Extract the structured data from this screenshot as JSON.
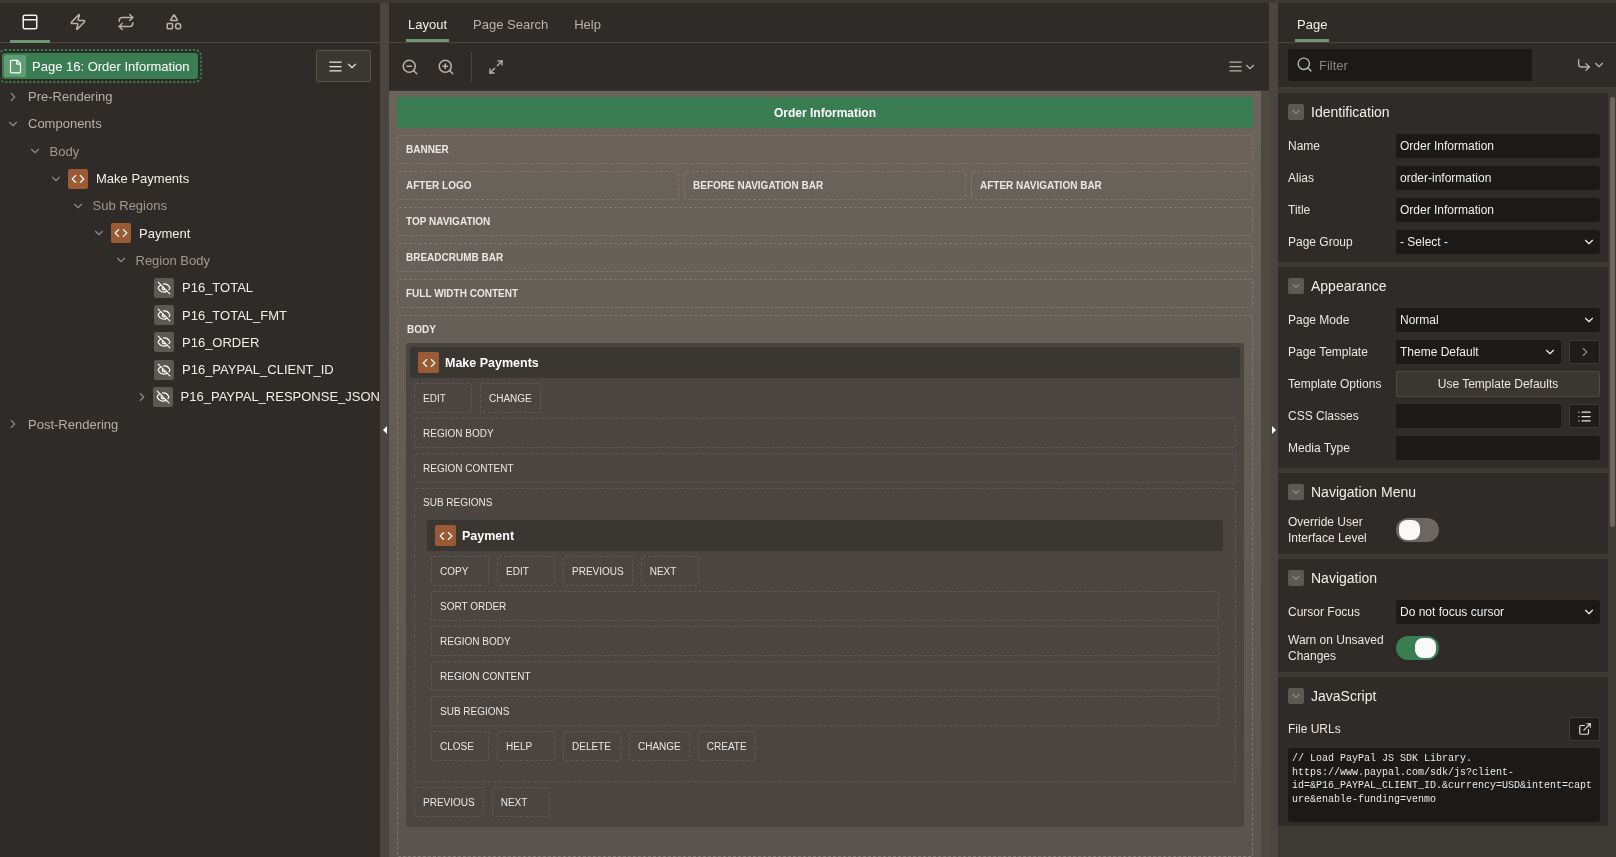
{
  "left_tabs": [
    {
      "kind": "rendering",
      "selected": true
    },
    {
      "kind": "dynamic_actions",
      "selected": false
    },
    {
      "kind": "processing",
      "selected": false
    },
    {
      "kind": "shared_components",
      "selected": false
    }
  ],
  "tree": {
    "label": "Page 16: Order Information",
    "selected": true,
    "children": [
      {
        "kind": "group",
        "label": "Pre-Rendering",
        "expanded": false
      },
      {
        "kind": "group",
        "label": "Components",
        "expanded": true,
        "children": [
          {
            "kind": "folder",
            "label": "Body",
            "expanded": true,
            "children": [
              {
                "kind": "region",
                "label": "Make Payments",
                "expanded": true,
                "children": [
                  {
                    "kind": "folder",
                    "label": "Sub Regions",
                    "expanded": true,
                    "children": [
                      {
                        "kind": "region",
                        "label": "Payment",
                        "expanded": true,
                        "children": [
                          {
                            "kind": "folder",
                            "label": "Region Body",
                            "expanded": true,
                            "children": [
                              {
                                "kind": "item",
                                "label": "P16_TOTAL"
                              },
                              {
                                "kind": "item",
                                "label": "P16_TOTAL_FMT"
                              },
                              {
                                "kind": "item",
                                "label": "P16_ORDER"
                              },
                              {
                                "kind": "item",
                                "label": "P16_PAYPAL_CLIENT_ID"
                              },
                              {
                                "kind": "item",
                                "label": "P16_PAYPAL_RESPONSE_JSON",
                                "expanded": false
                              }
                            ]
                          }
                        ]
                      }
                    ]
                  }
                ]
              }
            ]
          }
        ]
      },
      {
        "kind": "group",
        "label": "Post-Rendering",
        "expanded": false
      }
    ]
  },
  "center_tabs": [
    {
      "label": "Layout",
      "selected": true
    },
    {
      "label": "Page Search",
      "selected": false
    },
    {
      "label": "Help",
      "selected": false
    }
  ],
  "canvas": {
    "title": "Order Information",
    "positions": [
      {
        "labels": [
          "BANNER"
        ]
      },
      {
        "labels": [
          "AFTER LOGO",
          "BEFORE NAVIGATION BAR",
          "AFTER NAVIGATION BAR"
        ]
      },
      {
        "labels": [
          "TOP NAVIGATION"
        ]
      },
      {
        "labels": [
          "BREADCRUMB BAR"
        ]
      },
      {
        "labels": [
          "FULL WIDTH CONTENT"
        ]
      }
    ],
    "body": {
      "label": "BODY",
      "regions": [
        {
          "title": "Make Payments",
          "top_buttons": [
            "EDIT",
            "CHANGE"
          ],
          "slots": [
            "REGION BODY",
            "REGION CONTENT"
          ],
          "sub_regions": {
            "label": "SUB REGIONS",
            "regions": [
              {
                "title": "Payment",
                "top_buttons": [
                  "COPY",
                  "EDIT",
                  "PREVIOUS",
                  "NEXT"
                ],
                "slots": [
                  "SORT ORDER",
                  "REGION BODY",
                  "REGION CONTENT",
                  "SUB REGIONS"
                ],
                "bottom_buttons": [
                  "CLOSE",
                  "HELP",
                  "DELETE",
                  "CHANGE",
                  "CREATE"
                ]
              }
            ]
          },
          "bottom_buttons": [
            "PREVIOUS",
            "NEXT"
          ]
        }
      ]
    }
  },
  "properties": {
    "tab": {
      "label": "Page",
      "selected": true
    },
    "filter": {
      "placeholder": "Filter"
    },
    "sections": [
      {
        "title": "Identification",
        "expanded": true,
        "fields": [
          {
            "kind": "text",
            "label": "Name",
            "value": "Order Information"
          },
          {
            "kind": "text",
            "label": "Alias",
            "value": "order-information"
          },
          {
            "kind": "text",
            "label": "Title",
            "value": "Order Information"
          },
          {
            "kind": "select",
            "label": "Page Group",
            "value": "- Select -"
          }
        ]
      },
      {
        "title": "Appearance",
        "expanded": true,
        "fields": [
          {
            "kind": "select",
            "label": "Page Mode",
            "value": "Normal"
          },
          {
            "kind": "select_link",
            "label": "Page Template",
            "value": "Theme Default"
          },
          {
            "kind": "button",
            "label": "Template Options",
            "value": "Use Template Defaults"
          },
          {
            "kind": "text_list",
            "label": "CSS Classes"
          },
          {
            "kind": "text",
            "label": "Media Type"
          }
        ]
      },
      {
        "title": "Navigation Menu",
        "expanded": true,
        "fields": [
          {
            "kind": "toggle",
            "label": "Override User Interface Level",
            "on": false
          }
        ]
      },
      {
        "title": "Navigation",
        "expanded": true,
        "fields": [
          {
            "kind": "select",
            "label": "Cursor Focus",
            "value": "Do not focus cursor"
          },
          {
            "kind": "toggle",
            "label": "Warn on Unsaved Changes",
            "on": true
          }
        ]
      },
      {
        "title": "JavaScript",
        "expanded": true,
        "fields": [
          {
            "kind": "code",
            "label": "File URLs",
            "value": "// Load PayPal JS SDK Library.\nhttps://www.paypal.com/sdk/js?client-id=&P16_PAYPAL_CLIENT_ID.&currency=USD&intent=capture&enable-funding=venmo"
          }
        ]
      }
    ]
  }
}
